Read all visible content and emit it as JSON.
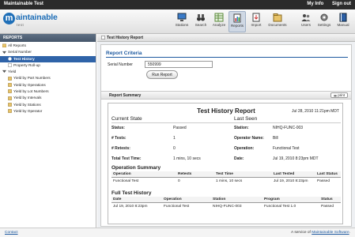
{
  "app": {
    "title": "Maintainable Test"
  },
  "topLinks": [
    "My Info",
    "Sign out"
  ],
  "logo": {
    "word": "aintainable",
    "letter": "m",
    "sub": "test"
  },
  "toolbar": [
    {
      "label": "Stations",
      "icon": "monitor-icon"
    },
    {
      "label": "Search",
      "icon": "binoculars-icon"
    },
    {
      "label": "Analyze",
      "icon": "spreadsheet-icon"
    },
    {
      "label": "Reports",
      "icon": "reports-icon",
      "active": true
    },
    {
      "label": "Import",
      "icon": "import-icon"
    },
    {
      "label": "Documents",
      "icon": "documents-icon"
    },
    {
      "label": "Users",
      "icon": "users-icon"
    },
    {
      "label": "Settings",
      "icon": "gear-icon"
    },
    {
      "label": "Manual",
      "icon": "book-icon"
    }
  ],
  "sidebar": {
    "header": "REPORTS",
    "items": [
      {
        "label": "All Reports"
      },
      {
        "label": "Serial Number"
      },
      {
        "label": "Test History",
        "selected": true
      },
      {
        "label": "Property Roll-up"
      },
      {
        "label": "Yield"
      },
      {
        "label": "Yield by Part Numbers"
      },
      {
        "label": "Yield by Operations"
      },
      {
        "label": "Yield by Lot Numbers"
      },
      {
        "label": "Yield by Intervals"
      },
      {
        "label": "Yield by Stations"
      },
      {
        "label": "Yield by Operator"
      }
    ]
  },
  "main": {
    "header": "Test History Report",
    "criteria": {
      "title": "Report Criteria",
      "serial_label": "Serial Number",
      "serial_value": "550999",
      "run_button": "Run Report"
    },
    "summary": {
      "header": "Report Summary",
      "print": "print",
      "title": "Test History Report",
      "date": "Jul 28, 2010 11:21pm MDT",
      "current_state": "Current State",
      "last_seen": "Last Seen",
      "left": [
        {
          "k": "Status:",
          "v": "Passed"
        },
        {
          "k": "# Tests:",
          "v": "1"
        },
        {
          "k": "# Retests:",
          "v": "0"
        },
        {
          "k": "Total Test Time:",
          "v": "1 mins, 10 secs"
        }
      ],
      "right": [
        {
          "k": "Station:",
          "v": "NIHQ-FUNC-003"
        },
        {
          "k": "Operator Name:",
          "v": "Bill"
        },
        {
          "k": "Operation:",
          "v": "Functional Test"
        },
        {
          "k": "Date:",
          "v": "Jul 19, 2010 8:23pm MDT"
        }
      ],
      "operation_summary": {
        "title": "Operation Summary",
        "columns": [
          "Operation",
          "Retests",
          "Test Time",
          "Last Tested",
          "Last Status"
        ],
        "rows": [
          [
            "Functional Test",
            "0",
            "1 mins, 10 secs",
            "Jul 19, 2010 8:23pm",
            "Passed"
          ]
        ]
      },
      "full_history": {
        "title": "Full Test History",
        "columns": [
          "Date",
          "Operation",
          "Station",
          "Program",
          "Status"
        ],
        "rows": [
          [
            "Jul 19, 2010 8:23pm",
            "Functional Test",
            "NIHQ-FUNC-003",
            "Functional Test 1.0",
            "Passed"
          ]
        ]
      }
    }
  },
  "footer": {
    "contact": "Contact",
    "service_prefix": "A service of",
    "service_link": "Maintainable Software",
    "service_suffix": "."
  },
  "colors": {
    "accent": "#1e5aa0",
    "selected": "#2f63a8",
    "titlebar": "#2b2b2b"
  }
}
